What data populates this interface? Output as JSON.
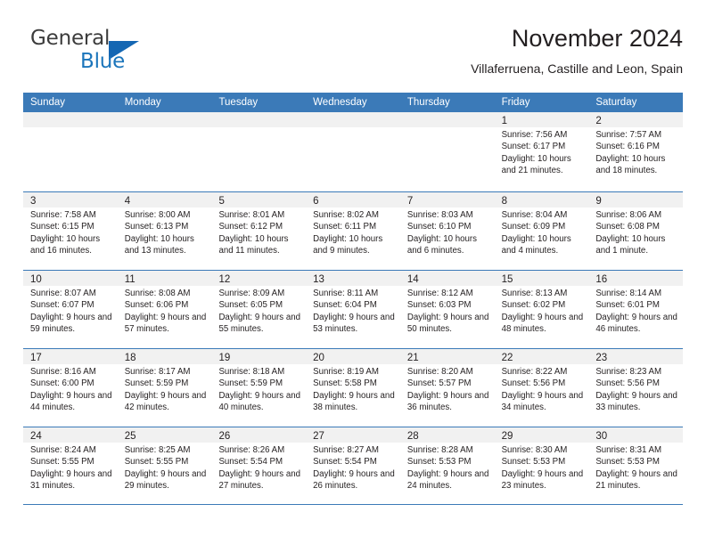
{
  "brand": {
    "name_part1": "General",
    "name_part2": "Blue",
    "flag_icon": "triangle-flag-icon",
    "accent_color": "#1b75bb"
  },
  "header": {
    "title": "November 2024",
    "subtitle": "Villaferruena, Castille and Leon, Spain"
  },
  "calendar": {
    "header_color": "#3b7ab8",
    "day_band_color": "#f1f1f1",
    "weekdays": [
      "Sunday",
      "Monday",
      "Tuesday",
      "Wednesday",
      "Thursday",
      "Friday",
      "Saturday"
    ],
    "weeks": [
      [
        {
          "day": "",
          "empty": true
        },
        {
          "day": "",
          "empty": true
        },
        {
          "day": "",
          "empty": true
        },
        {
          "day": "",
          "empty": true
        },
        {
          "day": "",
          "empty": true
        },
        {
          "day": "1",
          "sunrise": "Sunrise: 7:56 AM",
          "sunset": "Sunset: 6:17 PM",
          "daylight": "Daylight: 10 hours and 21 minutes."
        },
        {
          "day": "2",
          "sunrise": "Sunrise: 7:57 AM",
          "sunset": "Sunset: 6:16 PM",
          "daylight": "Daylight: 10 hours and 18 minutes."
        }
      ],
      [
        {
          "day": "3",
          "sunrise": "Sunrise: 7:58 AM",
          "sunset": "Sunset: 6:15 PM",
          "daylight": "Daylight: 10 hours and 16 minutes."
        },
        {
          "day": "4",
          "sunrise": "Sunrise: 8:00 AM",
          "sunset": "Sunset: 6:13 PM",
          "daylight": "Daylight: 10 hours and 13 minutes."
        },
        {
          "day": "5",
          "sunrise": "Sunrise: 8:01 AM",
          "sunset": "Sunset: 6:12 PM",
          "daylight": "Daylight: 10 hours and 11 minutes."
        },
        {
          "day": "6",
          "sunrise": "Sunrise: 8:02 AM",
          "sunset": "Sunset: 6:11 PM",
          "daylight": "Daylight: 10 hours and 9 minutes."
        },
        {
          "day": "7",
          "sunrise": "Sunrise: 8:03 AM",
          "sunset": "Sunset: 6:10 PM",
          "daylight": "Daylight: 10 hours and 6 minutes."
        },
        {
          "day": "8",
          "sunrise": "Sunrise: 8:04 AM",
          "sunset": "Sunset: 6:09 PM",
          "daylight": "Daylight: 10 hours and 4 minutes."
        },
        {
          "day": "9",
          "sunrise": "Sunrise: 8:06 AM",
          "sunset": "Sunset: 6:08 PM",
          "daylight": "Daylight: 10 hours and 1 minute."
        }
      ],
      [
        {
          "day": "10",
          "sunrise": "Sunrise: 8:07 AM",
          "sunset": "Sunset: 6:07 PM",
          "daylight": "Daylight: 9 hours and 59 minutes."
        },
        {
          "day": "11",
          "sunrise": "Sunrise: 8:08 AM",
          "sunset": "Sunset: 6:06 PM",
          "daylight": "Daylight: 9 hours and 57 minutes."
        },
        {
          "day": "12",
          "sunrise": "Sunrise: 8:09 AM",
          "sunset": "Sunset: 6:05 PM",
          "daylight": "Daylight: 9 hours and 55 minutes."
        },
        {
          "day": "13",
          "sunrise": "Sunrise: 8:11 AM",
          "sunset": "Sunset: 6:04 PM",
          "daylight": "Daylight: 9 hours and 53 minutes."
        },
        {
          "day": "14",
          "sunrise": "Sunrise: 8:12 AM",
          "sunset": "Sunset: 6:03 PM",
          "daylight": "Daylight: 9 hours and 50 minutes."
        },
        {
          "day": "15",
          "sunrise": "Sunrise: 8:13 AM",
          "sunset": "Sunset: 6:02 PM",
          "daylight": "Daylight: 9 hours and 48 minutes."
        },
        {
          "day": "16",
          "sunrise": "Sunrise: 8:14 AM",
          "sunset": "Sunset: 6:01 PM",
          "daylight": "Daylight: 9 hours and 46 minutes."
        }
      ],
      [
        {
          "day": "17",
          "sunrise": "Sunrise: 8:16 AM",
          "sunset": "Sunset: 6:00 PM",
          "daylight": "Daylight: 9 hours and 44 minutes."
        },
        {
          "day": "18",
          "sunrise": "Sunrise: 8:17 AM",
          "sunset": "Sunset: 5:59 PM",
          "daylight": "Daylight: 9 hours and 42 minutes."
        },
        {
          "day": "19",
          "sunrise": "Sunrise: 8:18 AM",
          "sunset": "Sunset: 5:59 PM",
          "daylight": "Daylight: 9 hours and 40 minutes."
        },
        {
          "day": "20",
          "sunrise": "Sunrise: 8:19 AM",
          "sunset": "Sunset: 5:58 PM",
          "daylight": "Daylight: 9 hours and 38 minutes."
        },
        {
          "day": "21",
          "sunrise": "Sunrise: 8:20 AM",
          "sunset": "Sunset: 5:57 PM",
          "daylight": "Daylight: 9 hours and 36 minutes."
        },
        {
          "day": "22",
          "sunrise": "Sunrise: 8:22 AM",
          "sunset": "Sunset: 5:56 PM",
          "daylight": "Daylight: 9 hours and 34 minutes."
        },
        {
          "day": "23",
          "sunrise": "Sunrise: 8:23 AM",
          "sunset": "Sunset: 5:56 PM",
          "daylight": "Daylight: 9 hours and 33 minutes."
        }
      ],
      [
        {
          "day": "24",
          "sunrise": "Sunrise: 8:24 AM",
          "sunset": "Sunset: 5:55 PM",
          "daylight": "Daylight: 9 hours and 31 minutes."
        },
        {
          "day": "25",
          "sunrise": "Sunrise: 8:25 AM",
          "sunset": "Sunset: 5:55 PM",
          "daylight": "Daylight: 9 hours and 29 minutes."
        },
        {
          "day": "26",
          "sunrise": "Sunrise: 8:26 AM",
          "sunset": "Sunset: 5:54 PM",
          "daylight": "Daylight: 9 hours and 27 minutes."
        },
        {
          "day": "27",
          "sunrise": "Sunrise: 8:27 AM",
          "sunset": "Sunset: 5:54 PM",
          "daylight": "Daylight: 9 hours and 26 minutes."
        },
        {
          "day": "28",
          "sunrise": "Sunrise: 8:28 AM",
          "sunset": "Sunset: 5:53 PM",
          "daylight": "Daylight: 9 hours and 24 minutes."
        },
        {
          "day": "29",
          "sunrise": "Sunrise: 8:30 AM",
          "sunset": "Sunset: 5:53 PM",
          "daylight": "Daylight: 9 hours and 23 minutes."
        },
        {
          "day": "30",
          "sunrise": "Sunrise: 8:31 AM",
          "sunset": "Sunset: 5:53 PM",
          "daylight": "Daylight: 9 hours and 21 minutes."
        }
      ]
    ]
  }
}
